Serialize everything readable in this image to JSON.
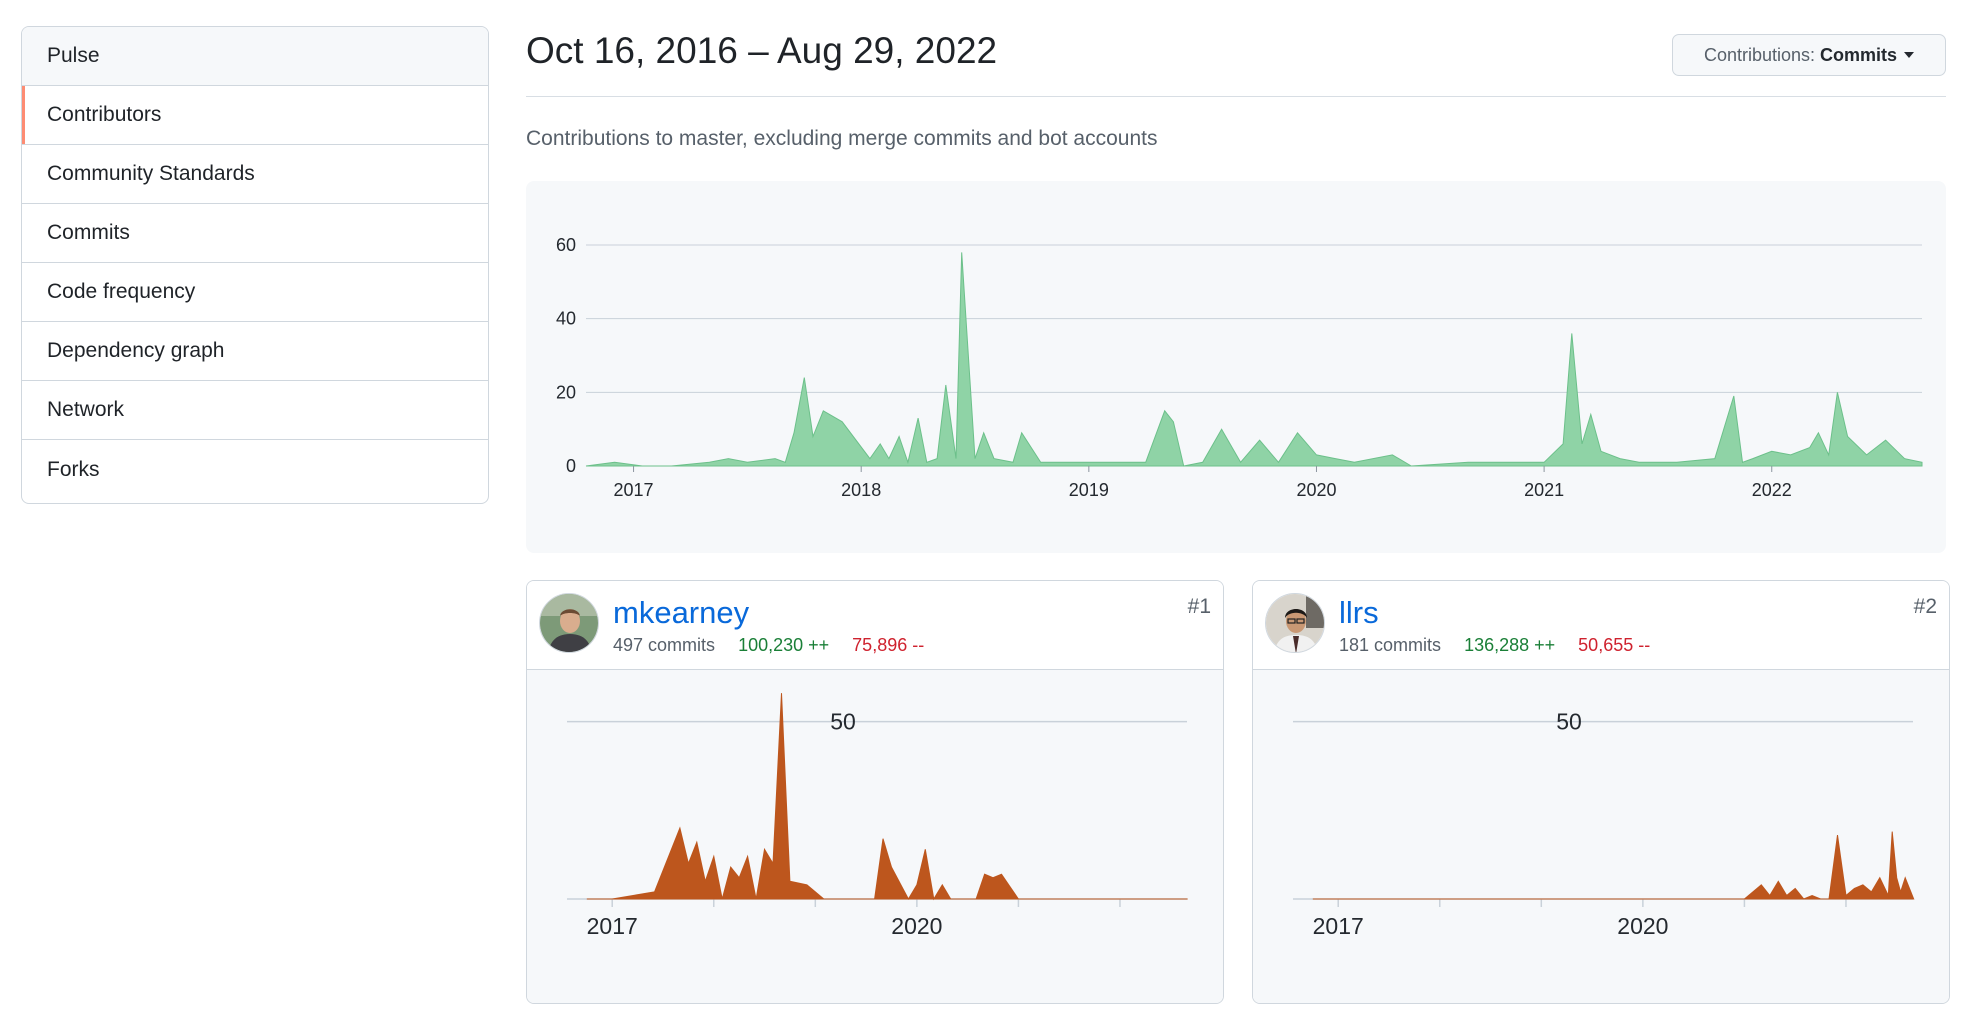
{
  "sidebar": {
    "items": [
      {
        "label": "Pulse"
      },
      {
        "label": "Contributors"
      },
      {
        "label": "Community Standards"
      },
      {
        "label": "Commits"
      },
      {
        "label": "Code frequency"
      },
      {
        "label": "Dependency graph"
      },
      {
        "label": "Network"
      },
      {
        "label": "Forks"
      }
    ]
  },
  "header": {
    "date_range": "Oct 16, 2016 – Aug 29, 2022",
    "dropdown_prefix": "Contributions:",
    "dropdown_value": "Commits",
    "subtitle": "Contributions to master, excluding merge commits and bot accounts"
  },
  "colors": {
    "main_area": "#8fd3a6",
    "main_area_stroke": "#6cc08a",
    "contributor_area": "#bd561d",
    "link": "#0969da",
    "additions": "#1a7f37",
    "deletions": "#cf222e",
    "active_marker": "#fd8c73"
  },
  "chart_data": [
    {
      "type": "area",
      "ylim": [
        0,
        60
      ],
      "y_ticks": [
        "0",
        "20",
        "40",
        "60"
      ],
      "x_ticks": [
        "2017",
        "2018",
        "2019",
        "2020",
        "2021",
        "2022"
      ],
      "grid": true,
      "x": [
        "2016-10-16",
        "2016-12-01",
        "2017-01-15",
        "2017-03-01",
        "2017-05-01",
        "2017-06-01",
        "2017-07-01",
        "2017-08-15",
        "2017-09-01",
        "2017-09-15",
        "2017-10-01",
        "2017-10-15",
        "2017-11-01",
        "2017-12-01",
        "2018-01-15",
        "2018-02-01",
        "2018-02-15",
        "2018-03-01",
        "2018-03-15",
        "2018-04-01",
        "2018-04-15",
        "2018-05-01",
        "2018-05-15",
        "2018-06-01",
        "2018-06-10",
        "2018-07-01",
        "2018-07-15",
        "2018-08-01",
        "2018-09-01",
        "2018-09-15",
        "2018-10-15",
        "2018-12-01",
        "2019-01-15",
        "2019-03-01",
        "2019-04-01",
        "2019-05-01",
        "2019-05-15",
        "2019-06-01",
        "2019-07-01",
        "2019-08-01",
        "2019-09-01",
        "2019-10-01",
        "2019-11-01",
        "2019-12-01",
        "2020-01-01",
        "2020-02-01",
        "2020-03-01",
        "2020-05-01",
        "2020-06-01",
        "2020-09-01",
        "2020-11-01",
        "2021-01-01",
        "2021-02-01",
        "2021-02-15",
        "2021-03-01",
        "2021-03-15",
        "2021-04-01",
        "2021-05-01",
        "2021-06-01",
        "2021-08-01",
        "2021-10-01",
        "2021-11-01",
        "2021-11-15",
        "2021-12-01",
        "2022-01-01",
        "2022-02-01",
        "2022-03-01",
        "2022-03-15",
        "2022-04-01",
        "2022-04-15",
        "2022-05-01",
        "2022-06-01",
        "2022-07-01",
        "2022-08-01",
        "2022-08-29"
      ],
      "values": [
        0,
        1,
        0,
        0,
        1,
        2,
        1,
        2,
        1,
        9,
        24,
        8,
        15,
        12,
        2,
        6,
        2,
        8,
        1,
        13,
        1,
        2,
        22,
        2,
        58,
        2,
        9,
        2,
        1,
        9,
        1,
        1,
        1,
        1,
        1,
        15,
        12,
        0,
        1,
        10,
        1,
        7,
        1,
        9,
        3,
        2,
        1,
        3,
        0,
        1,
        1,
        1,
        6,
        36,
        6,
        14,
        4,
        2,
        1,
        1,
        2,
        19,
        1,
        2,
        4,
        3,
        5,
        9,
        3,
        20,
        8,
        3,
        7,
        2,
        1
      ]
    },
    {
      "type": "area",
      "series": [
        {
          "name": "mkearney",
          "values": [
            0,
            0,
            2,
            20,
            10,
            16,
            5,
            12,
            0,
            9,
            6,
            12,
            0,
            14,
            10,
            58,
            5,
            4,
            0,
            0,
            0,
            0,
            17,
            9,
            0,
            4,
            14,
            0,
            4,
            0,
            0,
            0,
            7,
            6,
            7,
            0,
            0,
            0,
            0,
            0,
            0,
            0,
            0,
            0,
            0,
            0,
            0
          ]
        }
      ],
      "x": [
        "2016-10",
        "2017-01",
        "2017-06",
        "2017-09",
        "2017-10",
        "2017-11",
        "2017-12",
        "2018-01",
        "2018-02",
        "2018-03",
        "2018-04",
        "2018-05",
        "2018-06",
        "2018-07",
        "2018-08",
        "2018-09",
        "2018-10",
        "2018-12",
        "2019-02",
        "2019-04",
        "2019-06",
        "2019-08",
        "2019-09",
        "2019-10",
        "2019-12",
        "2020-01",
        "2020-02",
        "2020-03",
        "2020-04",
        "2020-05",
        "2020-06",
        "2020-08",
        "2020-09",
        "2020-10",
        "2020-11",
        "2021-01",
        "2021-03",
        "2021-05",
        "2021-07",
        "2021-09",
        "2021-11",
        "2022-01",
        "2022-03",
        "2022-05",
        "2022-07",
        "2022-08",
        "2022-09"
      ],
      "y_ticks": [
        "50"
      ],
      "x_ticks": [
        "2017",
        "2020"
      ]
    },
    {
      "type": "area",
      "series": [
        {
          "name": "llrs",
          "values": [
            0,
            0,
            0,
            0,
            2,
            4,
            1,
            5,
            1,
            3,
            0,
            1,
            0,
            0,
            18,
            1,
            3,
            4,
            2,
            6,
            1,
            19,
            6,
            2,
            6,
            0
          ]
        }
      ],
      "x": [
        "2016-10",
        "2018-01",
        "2020-01",
        "2021-01",
        "2021-02",
        "2021-03",
        "2021-04",
        "2021-05",
        "2021-06",
        "2021-07",
        "2021-08",
        "2021-09",
        "2021-10",
        "2021-11",
        "2021-12",
        "2022-01",
        "2022-02",
        "2022-03",
        "2022-04",
        "2022-05",
        "2022-06",
        "2022-06-15",
        "2022-07",
        "2022-07-15",
        "2022-08",
        "2022-09"
      ],
      "y_ticks": [
        "50"
      ],
      "x_ticks": [
        "2017",
        "2020"
      ]
    }
  ],
  "contributors": [
    {
      "username": "mkearney",
      "commits": "497 commits",
      "additions": "100,230 ++",
      "deletions": "75,896 --",
      "rank": "#1"
    },
    {
      "username": "llrs",
      "commits": "181 commits",
      "additions": "136,288 ++",
      "deletions": "50,655 --",
      "rank": "#2"
    }
  ]
}
